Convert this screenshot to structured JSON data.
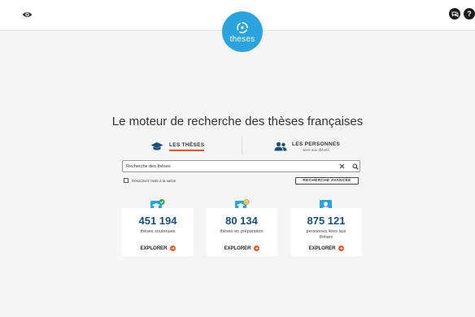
{
  "logo": {
    "text": "theses"
  },
  "headline": "Le moteur de recherche des thèses françaises",
  "tabs": {
    "theses": {
      "label": "LES THÈSES"
    },
    "personnes": {
      "label": "LES PERSONNES",
      "sub": "liées aux thèses"
    }
  },
  "search": {
    "value": "Recherche des thèses",
    "assist_label": "Désactiver l'aide à la saisie",
    "advanced_label": "RECHERCHE AVANCÉE"
  },
  "stats": [
    {
      "number": "451 194",
      "label": "thèses soutenues",
      "link": "EXPLORER"
    },
    {
      "number": "80 134",
      "label": "thèses en préparation",
      "link": "EXPLORER"
    },
    {
      "number": "875 121",
      "label": "personnes liées aux thèses",
      "link": "EXPLORER"
    }
  ],
  "colors": {
    "brand_blue": "#2ba3df",
    "number_blue": "#1b4f78",
    "accent_orange": "#e8552b",
    "success_green": "#3aa35a"
  },
  "icons": {
    "accessibility": "eye-icon",
    "contact": "chat-icon",
    "help": "help-icon",
    "clear": "close-icon",
    "search": "search-icon",
    "tab_theses": "graduation-cap-icon",
    "tab_personnes": "people-icon",
    "card_soutenues": "graduation-badge-check-icon",
    "card_preparation": "graduation-badge-clock-icon",
    "card_personnes": "person-badge-icon",
    "explore": "arrow-right-circle-icon"
  }
}
